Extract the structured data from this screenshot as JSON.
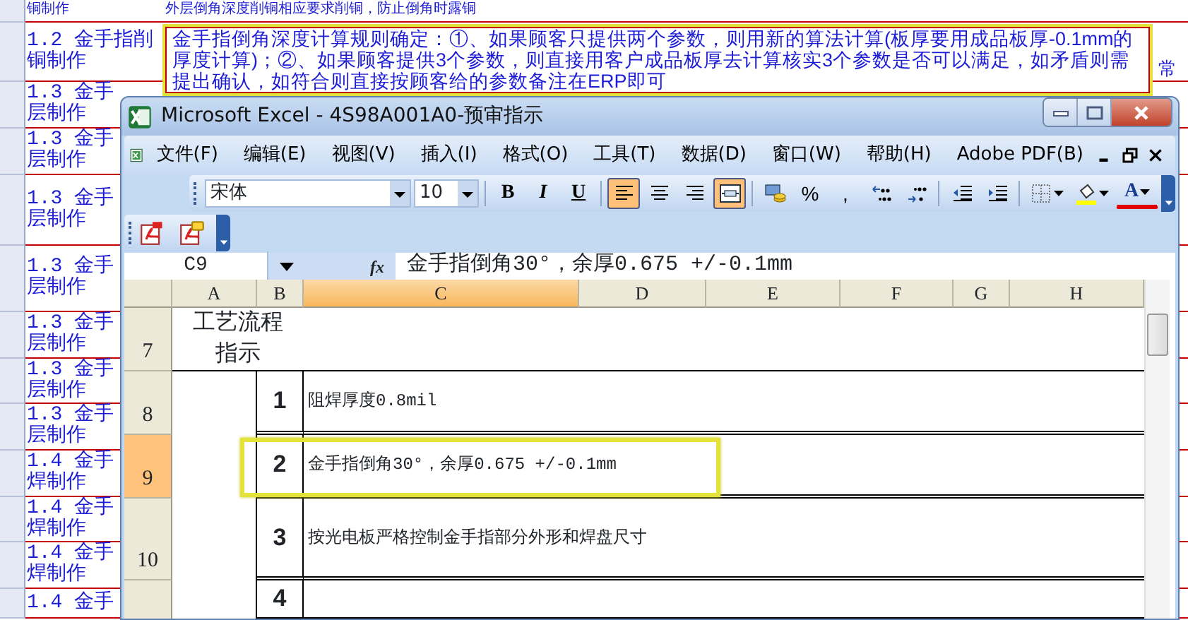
{
  "background_sheet": {
    "top_note": "外层倒角深度削铜相应要求削铜，防止倒角时露铜",
    "side_labels": [
      {
        "line_1": "铜制作"
      },
      {
        "line_1": "1.2 金手指削",
        "line_2": "铜制作"
      },
      {
        "line_1": "1.3 金手",
        "line_2": "层制作"
      },
      {
        "line_1": "1.3 金手",
        "line_2": "层制作"
      },
      {
        "line_1": "1.3 金手",
        "line_2": "层制作"
      },
      {
        "line_1": "1.3 金手",
        "line_2": "层制作"
      },
      {
        "line_1": "1.3 金手",
        "line_2": "层制作"
      },
      {
        "line_1": "1.3 金手",
        "line_2": "层制作"
      },
      {
        "line_1": "1.3 金手",
        "line_2": "层制作"
      },
      {
        "line_1": "1.4 金手",
        "line_2": "焊制作"
      },
      {
        "line_1": "1.4 金手",
        "line_2": "焊制作"
      },
      {
        "line_1": "1.4 金手",
        "line_2": "焊制作"
      },
      {
        "line_1": "1.4 金手"
      }
    ],
    "comment": "金手指倒角深度计算规则确定：①、如果顾客只提供两个参数，则用新的算法计算(板厚要用成品板厚-0.1mm的厚度计算)；②、如果顾客提供3个参数，则直接用客户成品板厚去计算核实3个参数是否可以满足，如矛盾则需提出确认，如符合则直接按顾客给的参数备注在ERP即可",
    "right_note": "常"
  },
  "excel": {
    "title": "Microsoft Excel - 4S98A001A0-预审指示",
    "menus": [
      "文件(F)",
      "编辑(E)",
      "视图(V)",
      "插入(I)",
      "格式(O)",
      "工具(T)",
      "数据(D)",
      "窗口(W)",
      "帮助(H)",
      "Adobe PDF(B)"
    ],
    "font_name": "宋体",
    "font_size": "10",
    "toolbar": [
      {
        "kind": "bold",
        "label": "B",
        "pressed": false
      },
      {
        "kind": "italic",
        "label": "I",
        "pressed": false
      },
      {
        "kind": "underline",
        "label": "U",
        "pressed": false
      },
      {
        "kind": "sep"
      },
      {
        "kind": "align-left",
        "pressed": true
      },
      {
        "kind": "align-center",
        "pressed": false
      },
      {
        "kind": "align-right",
        "pressed": false
      },
      {
        "kind": "merge",
        "pressed": true
      },
      {
        "kind": "sep"
      },
      {
        "kind": "currency",
        "pressed": false
      },
      {
        "kind": "percent",
        "label": "%",
        "pressed": false
      },
      {
        "kind": "comma",
        "label": ",",
        "pressed": false
      },
      {
        "kind": "inc-decimal",
        "pressed": false
      },
      {
        "kind": "dec-decimal",
        "pressed": false
      },
      {
        "kind": "sep"
      },
      {
        "kind": "outdent",
        "pressed": false
      },
      {
        "kind": "indent",
        "pressed": false
      },
      {
        "kind": "sep"
      },
      {
        "kind": "borders",
        "pressed": false
      },
      {
        "kind": "fill-color",
        "pressed": false
      },
      {
        "kind": "font-color",
        "label": "A",
        "pressed": false
      }
    ],
    "name_box": "C9",
    "function_label": "fx",
    "formula": "金手指倒角30°，余厚0.675 +/-0.1mm",
    "columns": [
      {
        "label": "A",
        "selected": false
      },
      {
        "label": "B",
        "selected": false
      },
      {
        "label": "C",
        "selected": true
      },
      {
        "label": "D",
        "selected": false
      },
      {
        "label": "E",
        "selected": false
      },
      {
        "label": "F",
        "selected": false
      },
      {
        "label": "G",
        "selected": false
      },
      {
        "label": "H",
        "selected": false
      }
    ],
    "rows": [
      {
        "number": "7",
        "selected": false,
        "kind": "title",
        "lines": [
          "工艺流程",
          "指示"
        ]
      },
      {
        "number": "8",
        "selected": false,
        "kind": "step",
        "step": "1",
        "text": "阻焊厚度0.8mil"
      },
      {
        "number": "9",
        "selected": true,
        "kind": "step",
        "step": "2",
        "text": "金手指倒角30°，余厚0.675 +/-0.1mm"
      },
      {
        "number": "10",
        "selected": false,
        "kind": "step",
        "step": "3",
        "text": "按光电板严格控制金手指部分外形和焊盘尺寸"
      },
      {
        "selected": false,
        "kind": "step",
        "step": "4"
      }
    ]
  }
}
